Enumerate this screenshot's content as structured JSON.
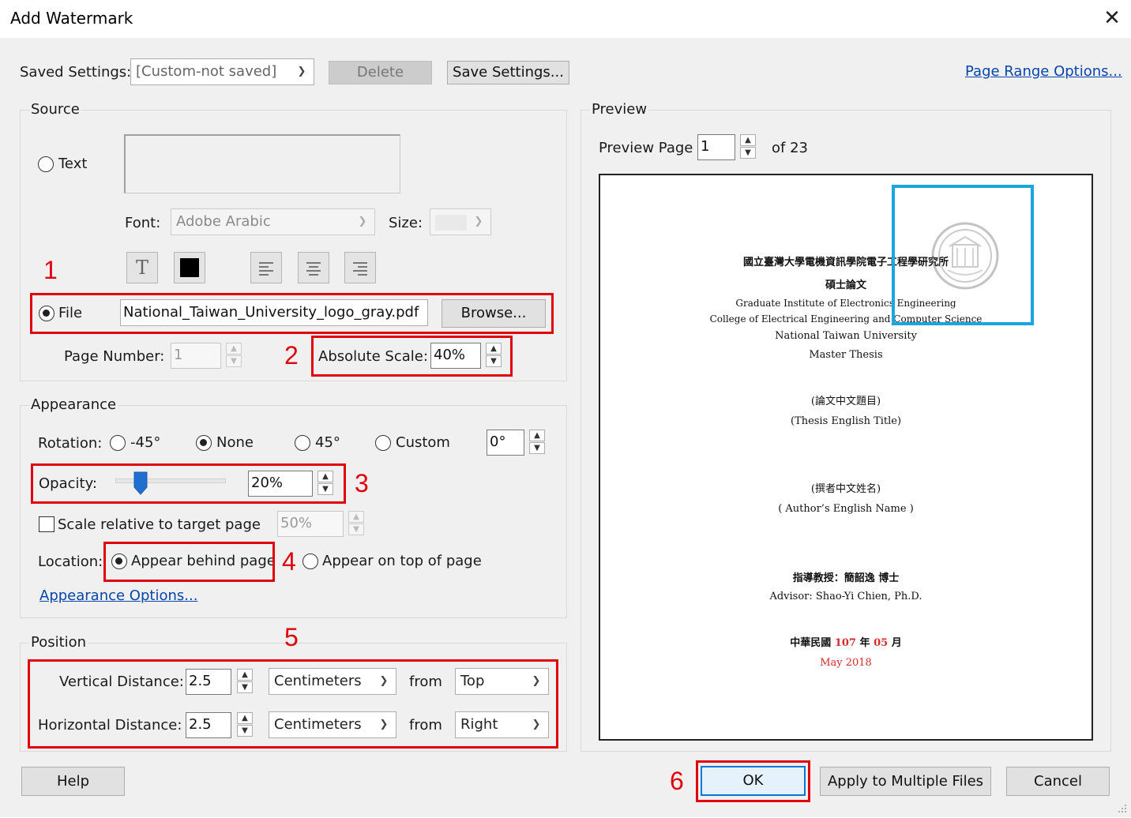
{
  "window": {
    "title": "Add Watermark",
    "close": "✕"
  },
  "saved_settings": {
    "label": "Saved Settings:",
    "value": "[Custom-not saved]",
    "delete": "Delete",
    "save": "Save Settings...",
    "page_range": "Page Range Options..."
  },
  "source": {
    "title": "Source",
    "text_label": "Text",
    "font_label": "Font:",
    "font_value": "Adobe Arabic",
    "size_label": "Size:",
    "bold_glyph": "T",
    "file_label": "File",
    "file_value": "National_Taiwan_University_logo_gray.pdf",
    "browse": "Browse...",
    "page_number_label": "Page Number:",
    "page_number_value": "1",
    "scale_label": "Absolute Scale:",
    "scale_value": "40%"
  },
  "appearance": {
    "title": "Appearance",
    "rotation_label": "Rotation:",
    "rot_neg45": "-45°",
    "rot_none": "None",
    "rot_45": "45°",
    "rot_custom": "Custom",
    "rot_custom_value": "0°",
    "opacity_label": "Opacity:",
    "opacity_value": "20%",
    "opacity_fraction": 0.2,
    "scale_relative_label": "Scale relative to target page",
    "scale_relative_value": "50%",
    "location_label": "Location:",
    "behind": "Appear behind page",
    "on_top": "Appear on top of page",
    "options_link": "Appearance Options..."
  },
  "position": {
    "title": "Position",
    "vertical_label": "Vertical Distance:",
    "vertical_value": "2.5",
    "vertical_unit": "Centimeters",
    "vertical_from": "from",
    "vertical_anchor": "Top",
    "horizontal_label": "Horizontal Distance:",
    "horizontal_value": "2.5",
    "horizontal_unit": "Centimeters",
    "horizontal_from": "from",
    "horizontal_anchor": "Right"
  },
  "preview": {
    "title": "Preview",
    "page_label": "Preview Page",
    "page_value": "1",
    "of_label": "of 23",
    "doc": {
      "l1": "國立臺灣大學電機資訊學院電子工程學研究所",
      "l2": "碩士論文",
      "l3": "Graduate Institute of Electronics Engineering",
      "l4": "College of Electrical Engineering and Computer Science",
      "l5": "National Taiwan University",
      "l6": "Master Thesis",
      "l7": "(論文中文題目)",
      "l8": "(Thesis English Title)",
      "l9": "(撰者中文姓名)",
      "l10": "( Author’s English Name )",
      "l11": "指導教授：簡韶逸  博士",
      "l12": "Advisor: Shao-Yi Chien, Ph.D.",
      "l13a": "中華民國",
      "l13b": "107",
      "l13c": "年",
      "l13d": "05",
      "l13e": "月",
      "l14": "May 2018"
    }
  },
  "buttons": {
    "help": "Help",
    "ok": "OK",
    "apply": "Apply to Multiple Files",
    "cancel": "Cancel"
  },
  "annotations": {
    "n1": "1",
    "n2": "2",
    "n3": "3",
    "n4": "4",
    "n5": "5",
    "n6": "6"
  },
  "colors": {
    "annotation_red": "#e0000b",
    "highlight_blue": "#1aa7e0",
    "slider_blue": "#1f6fd0"
  }
}
